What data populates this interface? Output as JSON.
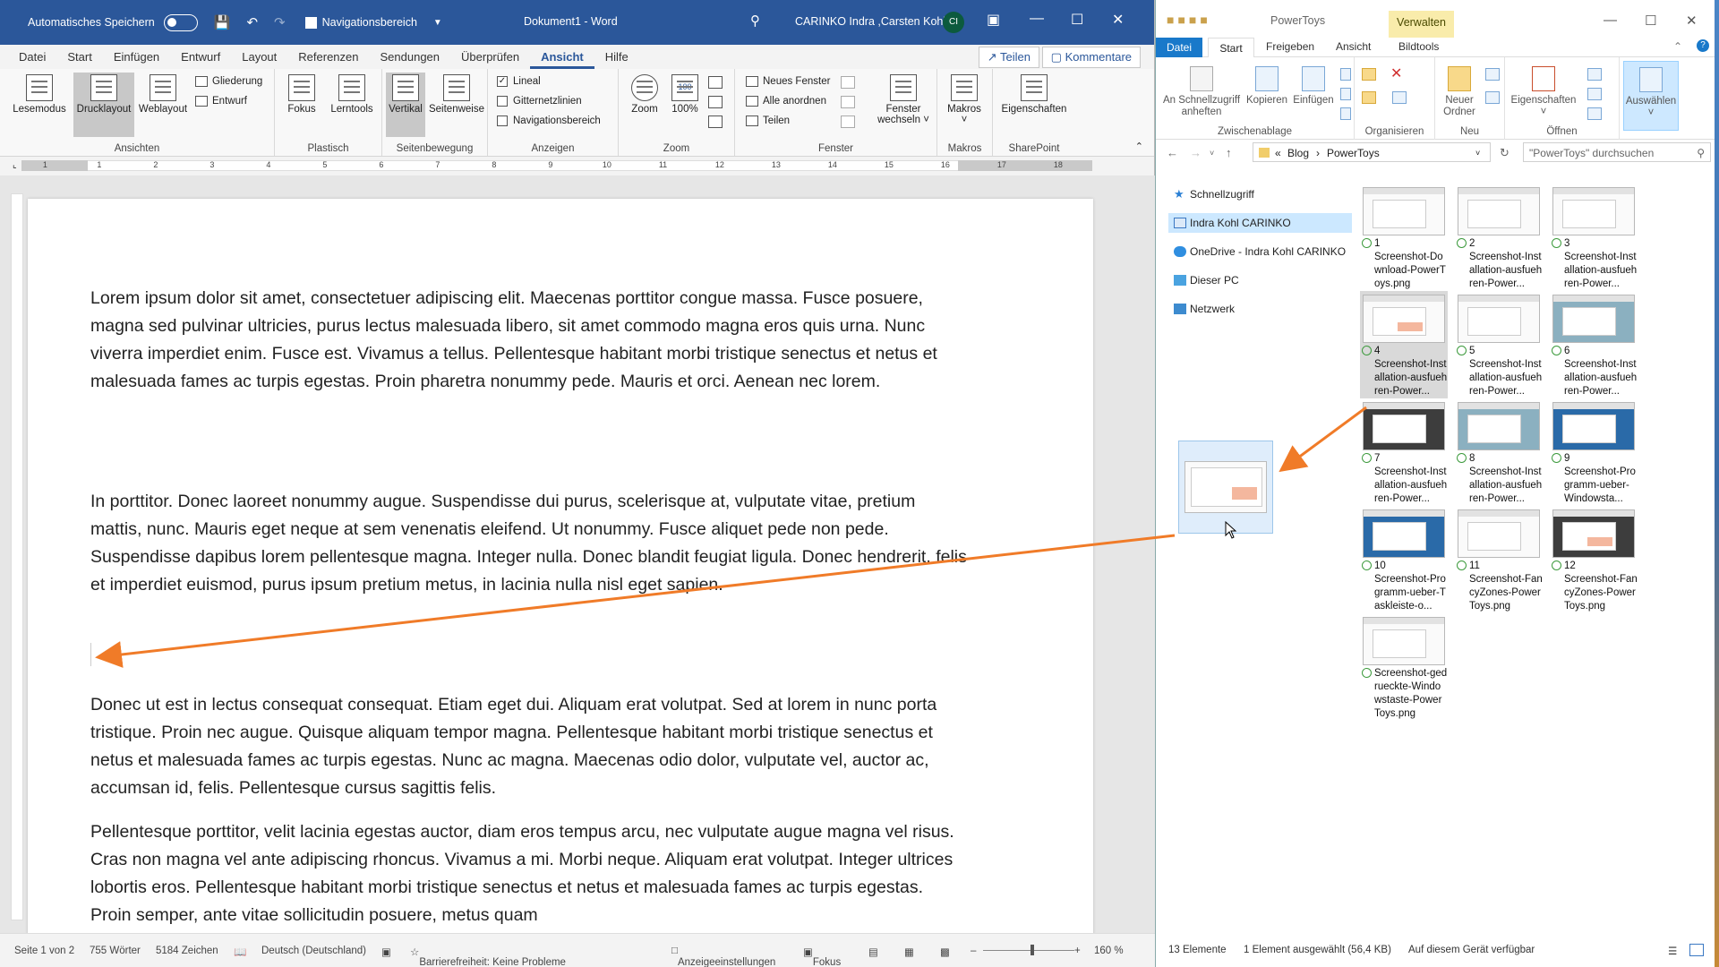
{
  "word": {
    "autosave_label": "Automatisches Speichern",
    "nav_pane_label": "Navigationsbereich",
    "doc_title": "Dokument1  -  Word",
    "user_name": "CARINKO Indra ,Carsten Kohl",
    "user_initials": "CI",
    "tabs": [
      "Datei",
      "Start",
      "Einfügen",
      "Entwurf",
      "Layout",
      "Referenzen",
      "Sendungen",
      "Überprüfen",
      "Ansicht",
      "Hilfe"
    ],
    "active_tab": "Ansicht",
    "share_label": "Teilen",
    "comments_label": "Kommentare",
    "ribbon": {
      "ansichten": {
        "label": "Ansichten",
        "lesemodus": "Lesemodus",
        "drucklayout": "Drucklayout",
        "weblayout": "Weblayout",
        "gliederung": "Gliederung",
        "entwurf": "Entwurf"
      },
      "plastisch": {
        "label": "Plastisch",
        "fokus": "Fokus",
        "lerntools": "Lerntools"
      },
      "seitenbewegung": {
        "label": "Seitenbewegung",
        "vertikal": "Vertikal",
        "seitenweise": "Seitenweise"
      },
      "anzeigen": {
        "label": "Anzeigen",
        "lineal": "Lineal",
        "gitternetzlinien": "Gitternetzlinien",
        "navigationsbereich": "Navigationsbereich"
      },
      "zoom": {
        "label": "Zoom",
        "zoom": "Zoom",
        "hundred": "100%",
        "hundred_icon": "100"
      },
      "fenster": {
        "label": "Fenster",
        "neues_fenster": "Neues Fenster",
        "alle_anordnen": "Alle anordnen",
        "teilen": "Teilen",
        "fenster_wechseln_1": "Fenster",
        "fenster_wechseln_2": "wechseln"
      },
      "makros": {
        "label": "Makros",
        "makros": "Makros"
      },
      "sharepoint": {
        "label": "SharePoint",
        "eigenschaften": "Eigenschaften"
      }
    },
    "ruler_numbers": [
      "1",
      "1",
      "2",
      "3",
      "4",
      "5",
      "6",
      "7",
      "8",
      "9",
      "10",
      "11",
      "12",
      "13",
      "14",
      "15",
      "16",
      "17",
      "18"
    ],
    "paragraphs": [
      "Lorem ipsum dolor sit amet, consectetuer adipiscing elit. Maecenas porttitor congue massa. Fusce posuere, magna sed pulvinar ultricies, purus lectus malesuada libero, sit amet commodo magna eros quis urna. Nunc viverra imperdiet enim. Fusce est. Vivamus a tellus. Pellentesque habitant morbi tristique senectus et netus et malesuada fames ac turpis egestas. Proin pharetra nonummy pede. Mauris et orci. Aenean nec lorem.",
      "In porttitor. Donec laoreet nonummy augue. Suspendisse dui purus, scelerisque at, vulputate vitae, pretium mattis, nunc. Mauris eget neque at sem venenatis eleifend. Ut nonummy. Fusce aliquet pede non pede. Suspendisse dapibus lorem pellentesque magna. Integer nulla. Donec blandit feugiat ligula. Donec hendrerit, felis et imperdiet euismod, purus ipsum pretium metus, in lacinia nulla nisl eget sapien.",
      "Donec ut est in lectus consequat consequat. Etiam eget dui. Aliquam erat volutpat. Sed at lorem in nunc porta tristique. Proin nec augue. Quisque aliquam tempor magna. Pellentesque habitant morbi tristique senectus et netus et malesuada fames ac turpis egestas. Nunc ac magna. Maecenas odio dolor, vulputate vel, auctor ac, accumsan id, felis. Pellentesque cursus sagittis felis.",
      "Pellentesque porttitor, velit lacinia egestas auctor, diam eros tempus arcu, nec vulputate augue magna vel risus. Cras non magna vel ante adipiscing rhoncus. Vivamus a mi. Morbi neque. Aliquam erat volutpat. Integer ultrices lobortis eros. Pellentesque habitant morbi tristique senectus et netus et malesuada fames ac turpis egestas. Proin semper, ante vitae sollicitudin posuere, metus quam"
    ],
    "status": {
      "page": "Seite 1 von 2",
      "words": "755 Wörter",
      "chars": "5184 Zeichen",
      "language": "Deutsch (Deutschland)",
      "accessibility": "Barrierefreiheit: Keine Probleme",
      "display_settings": "Anzeigeeinstellungen",
      "focus": "Fokus",
      "zoom": "160 %"
    },
    "accent_color": "#2b579a"
  },
  "explorer": {
    "title": "PowerToys",
    "manage_tab": "Verwalten",
    "tabs": {
      "datei": "Datei",
      "start": "Start",
      "freigeben": "Freigeben",
      "ansicht": "Ansicht",
      "bildtools": "Bildtools"
    },
    "ribbon": {
      "pin_1": "An Schnellzugriff",
      "pin_2": "anheften",
      "kopieren": "Kopieren",
      "einfuegen": "Einfügen",
      "zwischenablage": "Zwischenablage",
      "organisieren": "Organisieren",
      "neuer_ordner_1": "Neuer",
      "neuer_ordner_2": "Ordner",
      "neu": "Neu",
      "eigenschaften": "Eigenschaften",
      "oeffnen": "Öffnen",
      "auswaehlen": "Auswählen"
    },
    "address": {
      "prefix": "«",
      "part1": "Blog",
      "sep": "›",
      "part2": "PowerToys"
    },
    "search_placeholder": "\"PowerToys\" durchsuchen",
    "nav": [
      "Schnellzugriff",
      "Indra Kohl CARINKO",
      "OneDrive - Indra Kohl CARINKO",
      "Dieser PC",
      "Netzwerk"
    ],
    "files": [
      {
        "num": "1",
        "name": "Screenshot-Download-PowerToys.png"
      },
      {
        "num": "2",
        "name": "Screenshot-Installation-ausfuehren-Power..."
      },
      {
        "num": "3",
        "name": "Screenshot-Installation-ausfuehren-Power..."
      },
      {
        "num": "4",
        "name": "Screenshot-Installation-ausfuehren-Power..."
      },
      {
        "num": "5",
        "name": "Screenshot-Installation-ausfuehren-Power..."
      },
      {
        "num": "6",
        "name": "Screenshot-Installation-ausfuehren-Power..."
      },
      {
        "num": "7",
        "name": "Screenshot-Installation-ausfuehren-Power..."
      },
      {
        "num": "8",
        "name": "Screenshot-Installation-ausfuehren-Power..."
      },
      {
        "num": "9",
        "name": "Screenshot-Programm-ueber-Windowsta..."
      },
      {
        "num": "10",
        "name": "Screenshot-Programm-ueber-Taskleiste-o..."
      },
      {
        "num": "11",
        "name": "Screenshot-FancyZones-PowerToys.png"
      },
      {
        "num": "12",
        "name": "Screenshot-FancyZones-PowerToys.png"
      },
      {
        "num": "",
        "name": "Screenshot-gedrueckte-Windowstaste-PowerToys.png"
      }
    ],
    "status": {
      "count": "13 Elemente",
      "selected": "1 Element ausgewählt (56,4 KB)",
      "availability": "Auf diesem Gerät verfügbar"
    },
    "drag_arrow_color": "#f07b28"
  }
}
